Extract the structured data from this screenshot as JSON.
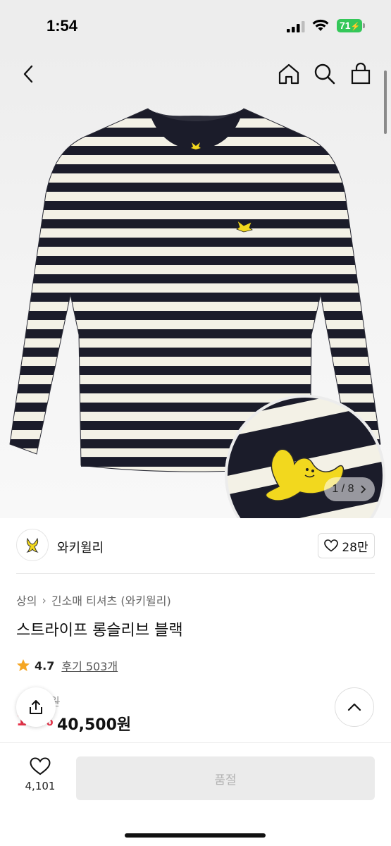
{
  "status_bar": {
    "time": "1:54",
    "battery": "71"
  },
  "hero": {
    "image_counter": {
      "current": "1",
      "separator": "/",
      "total": "8"
    },
    "icons": [
      "back-icon",
      "home-icon",
      "search-icon",
      "shopping-bag-icon"
    ],
    "colors": {
      "stripe_dark": "#1b1c2a",
      "stripe_light": "#f3f1e6",
      "logo_yellow": "#f2d81e"
    }
  },
  "brand": {
    "name": "와키윌리",
    "like_count": "28만"
  },
  "product": {
    "breadcrumb": [
      "상의",
      "긴소매 티셔츠 (와키윌리)"
    ],
    "title": "스트라이프 롱슬리브 블랙",
    "rating": "4.7",
    "reviews": "후기 503개",
    "original_price": "0원",
    "discount": "10%",
    "price": "40,500원"
  },
  "bottom_bar": {
    "wish_count": "4,101",
    "soldout_label": "품절"
  },
  "colors": {
    "discount_red": "#e8344a",
    "star": "#f5a623",
    "battery_green": "#34c759"
  }
}
